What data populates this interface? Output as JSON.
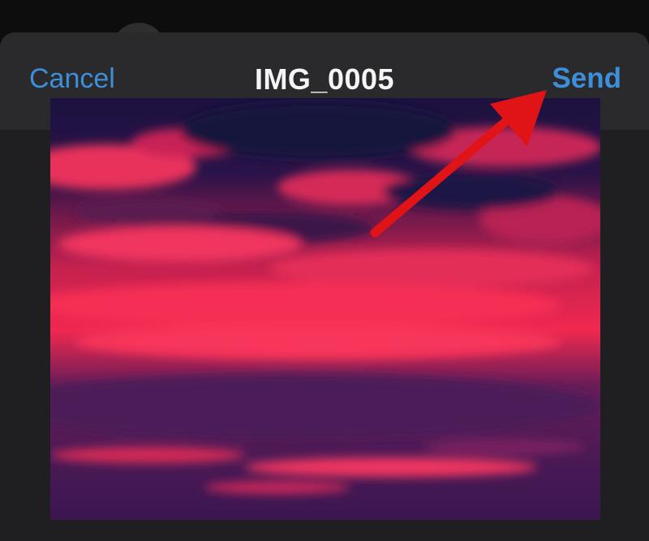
{
  "header": {
    "cancel_label": "Cancel",
    "title": "IMG_0005",
    "send_label": "Send"
  },
  "colors": {
    "accent": "#3d8fd9",
    "nav_background": "#2a2a2c",
    "sheet_background": "#1f1f21",
    "annotation_arrow": "#e01416"
  },
  "preview": {
    "subject": "sunset-sky-photo"
  },
  "annotation": {
    "icon": "red-arrow-icon",
    "points_to": "send-button"
  }
}
